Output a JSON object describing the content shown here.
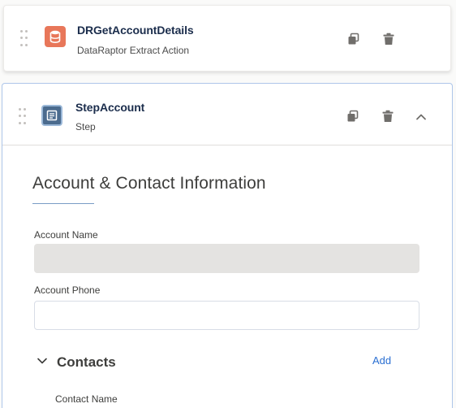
{
  "elements": [
    {
      "title": "DRGetAccountDetails",
      "subtitle": "DataRaptor Extract Action",
      "icon": "dataraptor-icon",
      "icon_color": "#e8775a"
    },
    {
      "title": "StepAccount",
      "subtitle": "Step",
      "icon": "step-icon",
      "icon_color": "#4b6b8e"
    }
  ],
  "section": {
    "title": "Account & Contact Information"
  },
  "fields": {
    "account_name": {
      "label": "Account Name",
      "value": ""
    },
    "account_phone": {
      "label": "Account Phone",
      "value": "",
      "placeholder": ""
    }
  },
  "contacts": {
    "label": "Contacts",
    "add_label": "Add",
    "contact_name_label": "Contact Name"
  },
  "colors": {
    "accent_link": "#2a6fd2",
    "selected_border": "#aec6ea"
  }
}
